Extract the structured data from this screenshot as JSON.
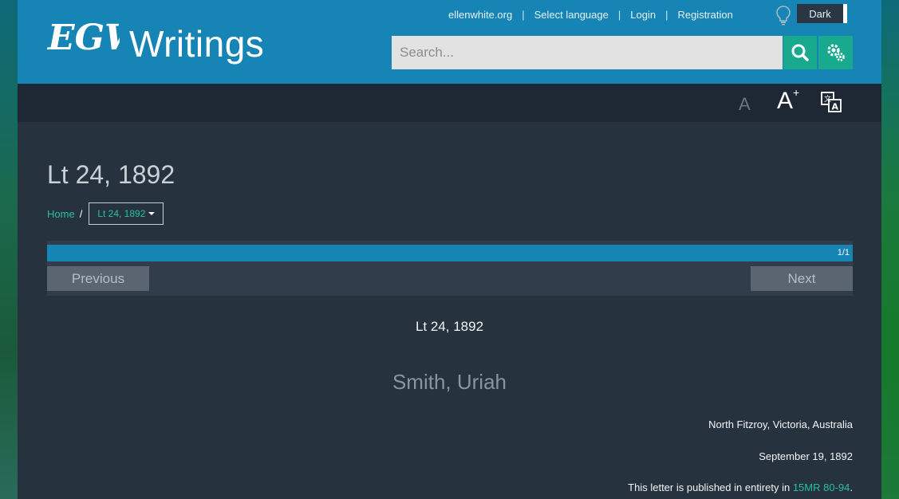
{
  "header": {
    "logo_text": "Writings",
    "logo_monogram": "EGW",
    "links": [
      "ellenwhite.org",
      "Select language",
      "Login",
      "Registration"
    ],
    "theme_toggle": "Dark",
    "search_placeholder": "Search..."
  },
  "toolbar": {
    "font_decrease": "A",
    "font_increase": "A",
    "font_increase_sup": "+",
    "icons": [
      "lightbulb-icon",
      "search-icon",
      "gear-icon",
      "translate-icon"
    ]
  },
  "page": {
    "title": "Lt 24, 1892",
    "breadcrumb": {
      "home": "Home",
      "separator": "/",
      "current": "Lt 24, 1892"
    },
    "pager": {
      "progress": 1.0,
      "page_count": "1/1",
      "previous": "Previous",
      "next": "Next"
    }
  },
  "document": {
    "title": "Lt 24, 1892",
    "addressee": "Smith, Uriah",
    "place": "North Fitzroy, Victoria, Australia",
    "date": "September 19, 1892",
    "note_prefix": "This letter is published in entirety in ",
    "note_link": "15MR 80-94",
    "note_suffix": "."
  },
  "colors": {
    "header_bg": "#1685b5",
    "accent_green": "#19a98e",
    "link_green": "#26c0a0",
    "content_bg": "#27323f"
  }
}
